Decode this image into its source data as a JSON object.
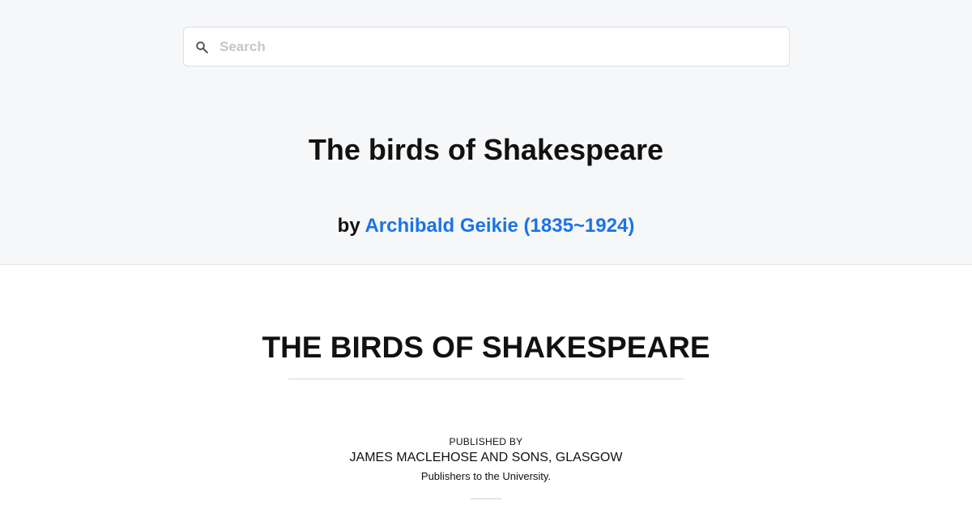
{
  "search": {
    "placeholder": "Search",
    "icon": "search-icon"
  },
  "book": {
    "title": "The birds of Shakespeare",
    "by_label": "by",
    "author": "Archibald Geikie (1835~1924)"
  },
  "content": {
    "heading": "THE BIRDS OF SHAKESPEARE",
    "published_by": "PUBLISHED BY",
    "publisher": "JAMES MACLEHOSE AND SONS, GLASGOW",
    "publisher_note": "Publishers to the University."
  },
  "colors": {
    "header_bg": "#f6f7f9",
    "link": "#1a73e8",
    "text": "#111111"
  }
}
